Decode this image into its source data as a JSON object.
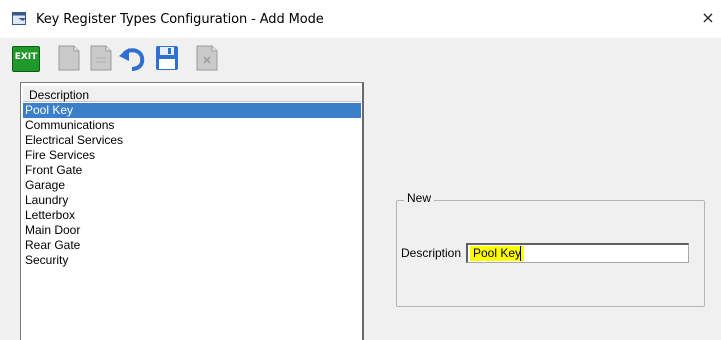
{
  "window": {
    "title": "Key Register Types Configuration - Add Mode",
    "close_glyph": "×"
  },
  "toolbar": {
    "exit_label": "EXIT",
    "buttons": [
      {
        "name": "exit-button",
        "icon": "exit-icon",
        "color": "#1f9a2a"
      },
      {
        "name": "new-record-button",
        "icon": "new-document-icon",
        "color": "#c8c8c8"
      },
      {
        "name": "copy-record-button",
        "icon": "copy-document-icon",
        "color": "#c8c8c8"
      },
      {
        "name": "undo-button",
        "icon": "undo-icon",
        "color": "#2f6fd0"
      },
      {
        "name": "save-button",
        "icon": "save-disk-icon",
        "color": "#2f6fd0"
      },
      {
        "name": "delete-button",
        "icon": "delete-document-icon",
        "color": "#c8c8c8"
      }
    ]
  },
  "list": {
    "header": "Description",
    "selected_index": 0,
    "items": [
      "Pool Key",
      "Communications",
      "Electrical Services",
      "Fire Services",
      "Front Gate",
      "Garage",
      "Laundry",
      "Letterbox",
      "Main Door",
      "Rear Gate",
      "Security"
    ]
  },
  "form": {
    "group_label": "New",
    "description_label": "Description",
    "description_value": "Pool Key",
    "highlight_color": "#ffff00"
  },
  "colors": {
    "selection": "#3a7fc8",
    "window_bg": "#f0f0f0"
  }
}
